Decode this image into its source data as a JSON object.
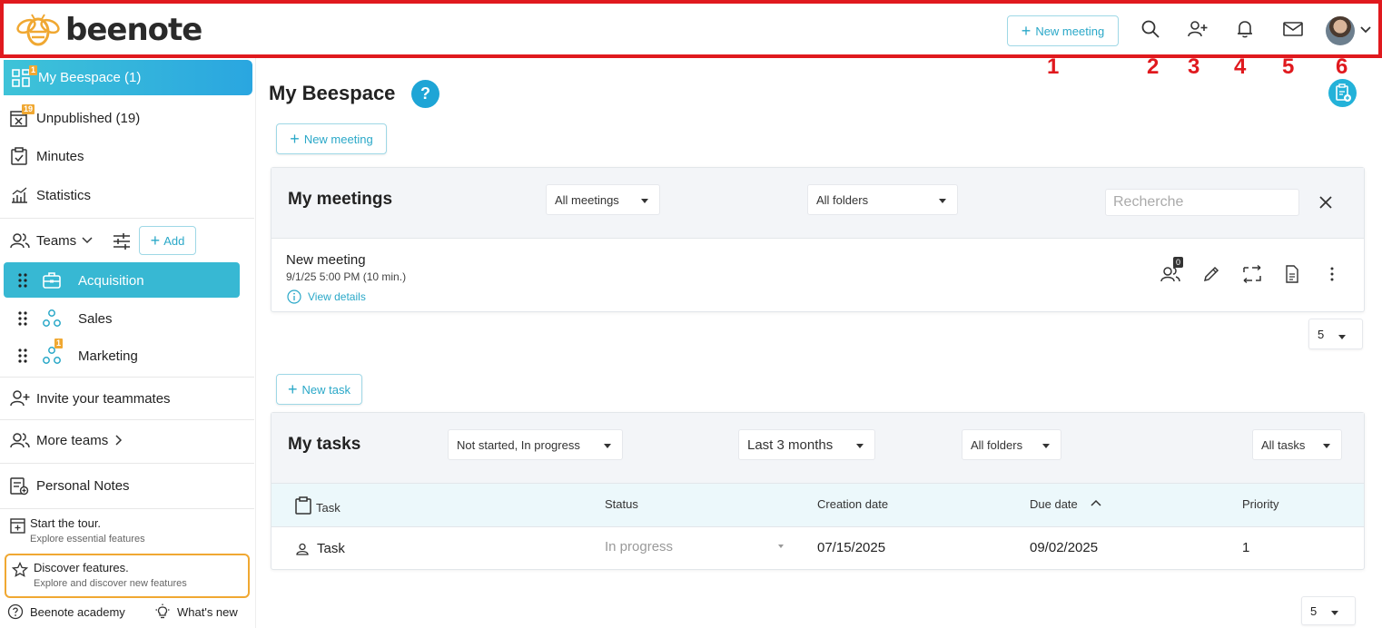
{
  "header": {
    "logo_text": "beenote",
    "new_meeting_label": "New meeting",
    "markers": [
      "1",
      "2",
      "3",
      "4",
      "5",
      "6"
    ],
    "icons": [
      "search-icon",
      "add-user-icon",
      "bell-icon",
      "mail-icon",
      "avatar",
      "chevron-down-icon"
    ]
  },
  "sidebar": {
    "my_beespace": {
      "label": "My Beespace (1)",
      "badge": "1"
    },
    "unpublished": {
      "label": "Unpublished (19)",
      "badge": "19"
    },
    "minutes": {
      "label": "Minutes"
    },
    "statistics": {
      "label": "Statistics"
    },
    "teams": {
      "label": "Teams",
      "add_label": "Add"
    },
    "team_items": [
      {
        "label": "Acquisition",
        "badge": ""
      },
      {
        "label": "Sales",
        "badge": ""
      },
      {
        "label": "Marketing",
        "badge": "1"
      }
    ],
    "invite": {
      "label": "Invite your teammates"
    },
    "more_teams": {
      "label": "More teams"
    },
    "personal_notes": {
      "label": "Personal Notes"
    },
    "tour": {
      "title": "Start the tour.",
      "subtitle": "Explore essential features"
    },
    "discover": {
      "title": "Discover features.",
      "subtitle": "Explore and discover new features"
    },
    "academy": {
      "label": "Beenote academy"
    },
    "whats_new": {
      "label": "What's new"
    }
  },
  "main": {
    "title": "My Beespace",
    "help_label": "?",
    "new_meeting_label": "New meeting",
    "new_task_label": "New task",
    "meetings": {
      "title": "My meetings",
      "filter_meetings": "All meetings",
      "filter_folders": "All folders",
      "search_placeholder": "Recherche",
      "items": [
        {
          "name": "New meeting",
          "when": "9/1/25 5:00 PM (10 min.)",
          "details_label": "View details",
          "participants": "0"
        }
      ],
      "page_size": "5"
    },
    "tasks": {
      "title": "My tasks",
      "filter_status": "Not started, In progress",
      "filter_period": "Last 3 months",
      "filter_folders": "All folders",
      "filter_tasks": "All tasks",
      "columns": {
        "task": "Task",
        "status": "Status",
        "creation": "Creation date",
        "due": "Due date",
        "priority": "Priority"
      },
      "rows": [
        {
          "task": "Task",
          "status": "In progress",
          "creation": "07/15/2025",
          "due": "09/02/2025",
          "priority": "1"
        }
      ],
      "page_size": "5"
    }
  },
  "colors": {
    "accent": "#2aa8c8",
    "highlight": "#e0191e",
    "badge": "#f0a832"
  }
}
